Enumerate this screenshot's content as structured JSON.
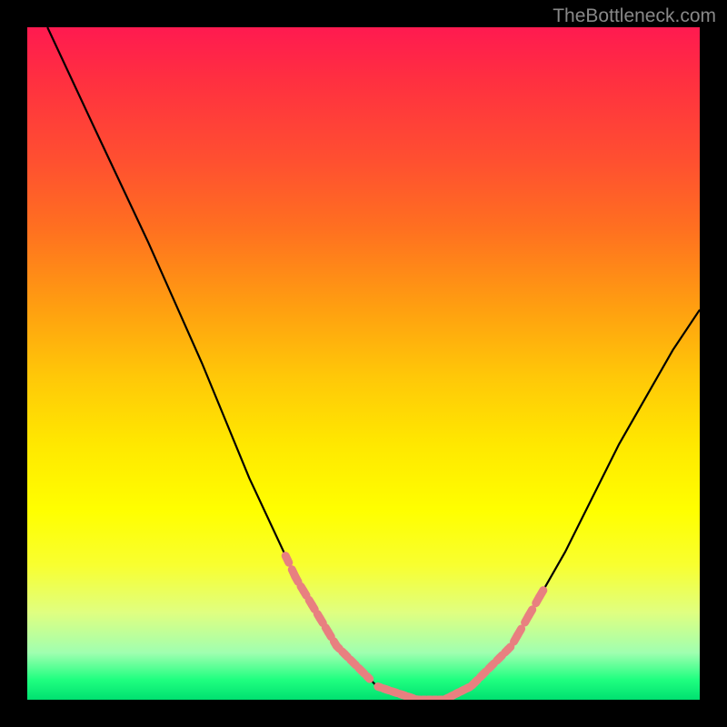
{
  "watermark": "TheBottleneck.com",
  "chart_data": {
    "type": "line",
    "title": "",
    "xlabel": "",
    "ylabel": "",
    "xlim": [
      0,
      100
    ],
    "ylim": [
      0,
      100
    ],
    "gradient_background": {
      "top": "#ff1a50",
      "mid_upper": "#ffa010",
      "mid": "#ffff00",
      "mid_lower": "#e0ff80",
      "bottom": "#00e070"
    },
    "curve": {
      "description": "V-shaped bottleneck curve descending from top-left to a minimum then rising to the right",
      "points_xy_percent": [
        [
          3,
          100
        ],
        [
          10,
          85
        ],
        [
          18,
          68
        ],
        [
          26,
          50
        ],
        [
          33,
          33
        ],
        [
          40,
          18
        ],
        [
          46,
          8
        ],
        [
          52,
          2
        ],
        [
          58,
          0
        ],
        [
          62,
          0
        ],
        [
          66,
          2
        ],
        [
          72,
          8
        ],
        [
          80,
          22
        ],
        [
          88,
          38
        ],
        [
          96,
          52
        ],
        [
          100,
          58
        ]
      ]
    },
    "highlight_segments": {
      "color": "#e88080",
      "description": "Dashed coral segments near the curve minimum",
      "left_branch_y_range_percent": [
        3,
        22
      ],
      "right_branch_y_range_percent": [
        2,
        18
      ],
      "bottom_flat_range_x_percent": [
        52,
        66
      ]
    }
  }
}
